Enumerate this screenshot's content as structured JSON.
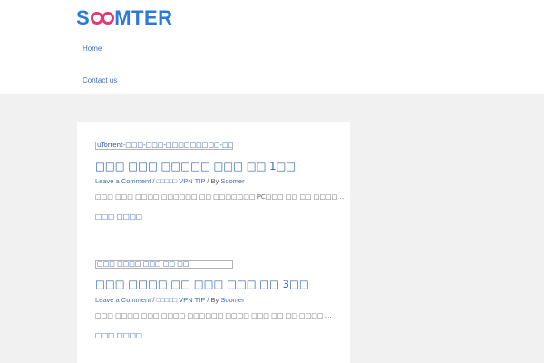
{
  "site": {
    "logo_left": "S",
    "logo_right": "MTER",
    "brand_blue": "#2a7ad6",
    "brand_pink": "#e0397a"
  },
  "nav": {
    "items": [
      {
        "label": "Home"
      },
      {
        "label": "Contact us"
      }
    ]
  },
  "posts": [
    {
      "thumb_alt": "uTorrent-□□□-□□□-□□□□□□□□□-□□□□",
      "title": "□□□ □□□ □□□□□ □□□ □□ 1□□",
      "comment_link": "Leave a Comment",
      "sep1": " / ",
      "category_prefix": "□□□□□",
      "category": " VPN TIP",
      "sep2": " / By ",
      "author": "Soomer",
      "excerpt": "□□□ □□□ □□□□ □□□□□□ □□ □□□□□□□ PC□□□ □□ □□ □□□□ …",
      "read_more": "□□□ □□□□"
    },
    {
      "thumb_alt": "□□□ □□□□ □□□ □□ □□",
      "title": "□□□ □□□□ □□ □□□ □□□ □□ 3□□",
      "comment_link": "Leave a Comment",
      "sep1": " / ",
      "category_prefix": "□□□□□",
      "category": " VPN TIP",
      "sep2": " / By ",
      "author": "Soomer",
      "excerpt": "□□□ □□□□ □□□ □□□□ □□□□□□ □□□□ □□□ □□ □□ □□□□ …",
      "read_more": "□□□ □□□□"
    }
  ]
}
